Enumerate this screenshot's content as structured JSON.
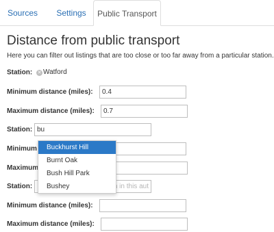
{
  "tabs": [
    {
      "label": "Sources"
    },
    {
      "label": "Settings"
    },
    {
      "label": "Public Transport"
    }
  ],
  "page": {
    "heading": "Distance from public transport",
    "intro": "Here you can filter out listings that are too close or too far away from a particular station."
  },
  "groups": [
    {
      "station_label": "Station:",
      "station_value": "Watford",
      "min_label": "Minimum distance (miles):",
      "min_value": "0.4",
      "max_label": "Maximum distance (miles):",
      "max_value": "0.7"
    },
    {
      "station_label": "Station:",
      "station_value": "bu",
      "min_label": "Minimum distance (miles):",
      "min_value": "",
      "max_label": "Maximum distance (miles):",
      "max_value": ""
    },
    {
      "station_label": "Station:",
      "station_placeholder": "n in this aut",
      "min_label": "Minimum distance (miles):",
      "min_value": "",
      "max_label": "Maximum distance (miles):",
      "max_value": ""
    }
  ],
  "autocomplete": {
    "options": [
      "Buckhurst Hill",
      "Burnt Oak",
      "Bush Hill Park",
      "Bushey"
    ],
    "active_index": 0
  }
}
